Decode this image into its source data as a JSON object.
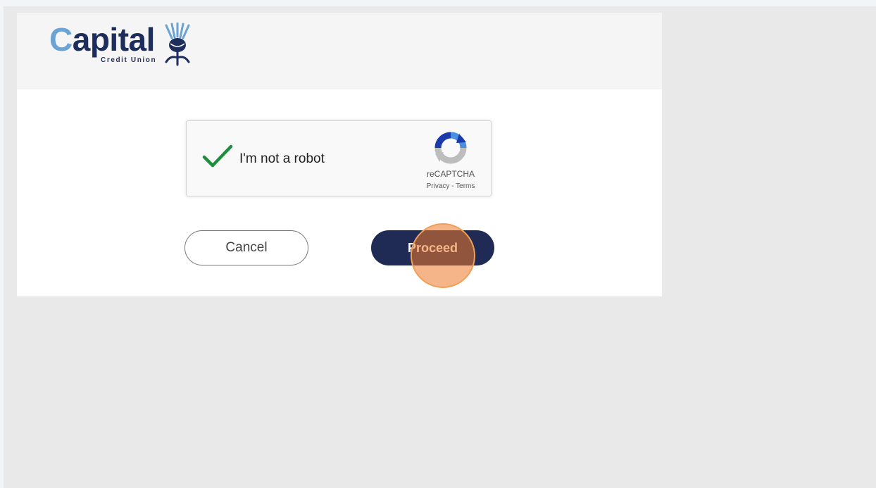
{
  "logo": {
    "name_part1": "C",
    "name_part2": "apital",
    "subtitle": "Credit Union",
    "colors": {
      "navy": "#1d2d5c",
      "light_blue": "#6aa3d4"
    }
  },
  "captcha": {
    "checkbox_state": "checked",
    "label": "I'm not a robot",
    "brand": "reCAPTCHA",
    "privacy_link": "Privacy",
    "separator": " - ",
    "terms_link": "Terms",
    "check_color": "#1e8e3e"
  },
  "actions": {
    "cancel_label": "Cancel",
    "proceed_label": "Proceed",
    "proceed_color": "#1f2a55"
  },
  "overlay": {
    "click_marker_target": "proceed-button",
    "marker_color": "#ec7828"
  }
}
